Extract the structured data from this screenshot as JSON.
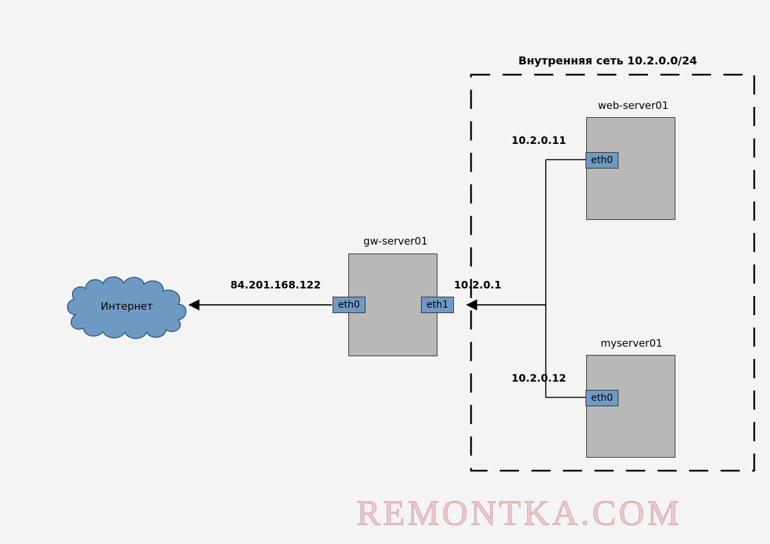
{
  "cloud": {
    "label": "Интернет"
  },
  "gateway": {
    "name": "gw-server01",
    "public_ip": "84.201.168.122",
    "iface_public": "eth0",
    "private_ip": "10.2.0.1",
    "iface_private": "eth1"
  },
  "network": {
    "title": "Внутренняя сеть 10.2.0.0/24"
  },
  "webserver": {
    "name": "web-server01",
    "ip": "10.2.0.11",
    "iface": "eth0"
  },
  "myserver": {
    "name": "myserver01",
    "ip": "10.2.0.12",
    "iface": "eth0"
  },
  "watermark": "REMONTKA.COM"
}
